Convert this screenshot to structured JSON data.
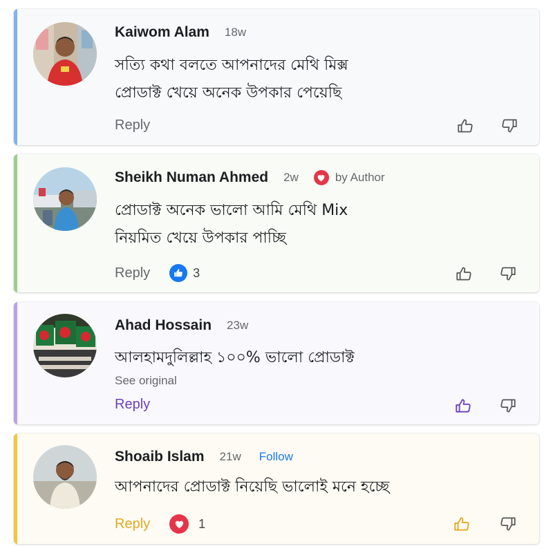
{
  "colors": {
    "blue_accent": "#7fb2ee",
    "green_accent": "#9dcf8b",
    "purple_accent": "#b8a2e4",
    "yellow_accent": "#f4c542",
    "purple_action": "#6a3fc1",
    "yellow_action": "#e3a81f",
    "follow_blue": "#1877f2",
    "heart_red": "#e4354a"
  },
  "comments": [
    {
      "author": "Kaiwom Alam",
      "time": "18w",
      "lines": [
        "সত্যি কথা বলতে আপনাদের মেথি মিক্স",
        "প্রোডাক্ট খেয়ে অনেক উপকার পেয়েছি"
      ],
      "reply_label": "Reply",
      "avatar_icon": "avatar-photo"
    },
    {
      "author": "Sheikh Numan Ahmed",
      "time": "2w",
      "badge": "by Author",
      "badge_icon": "heart-icon",
      "lines": [
        "প্রোডাক্ট অনেক ভালো আমি মেথি Mix",
        "নিয়মিত খেয়ে উপকার পাচ্ছি"
      ],
      "reply_label": "Reply",
      "reaction_icon": "like-icon",
      "reaction_count": "3",
      "avatar_icon": "avatar-photo"
    },
    {
      "author": "Ahad Hossain",
      "time": "23w",
      "lines": [
        "আলহামদুলিল্লাহ ১০০% ভালো প্রোডাক্ট"
      ],
      "see_original": "See original",
      "reply_label": "Reply",
      "avatar_icon": "avatar-flags"
    },
    {
      "author": "Shoaib Islam",
      "time": "21w",
      "follow_label": "Follow",
      "lines": [
        "আপনাদের প্রোডাক্ট নিয়েছি ভালোই মনে হচ্ছে"
      ],
      "reply_label": "Reply",
      "reaction_icon": "heart-icon",
      "reaction_count": "1",
      "avatar_icon": "avatar-photo"
    }
  ]
}
